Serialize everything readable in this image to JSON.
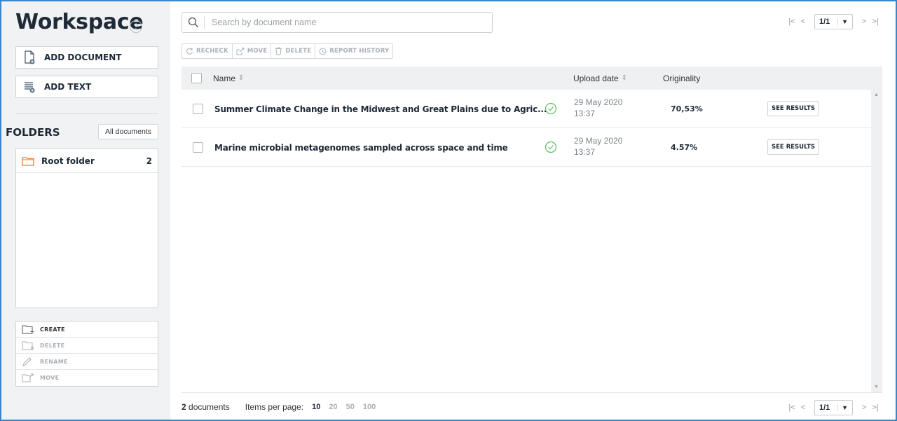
{
  "sidebar": {
    "title": "Workspace",
    "help_icon": "?",
    "add_document_label": "ADD DOCUMENT",
    "add_text_label": "ADD TEXT",
    "folders_title": "FOLDERS",
    "all_documents_label": "All documents",
    "folders": [
      {
        "name": "Root folder",
        "count": "2"
      }
    ],
    "folder_actions": [
      {
        "label": "CREATE",
        "icon": "folder-plus-icon",
        "enabled": true
      },
      {
        "label": "DELETE",
        "icon": "folder-delete-icon",
        "enabled": false
      },
      {
        "label": "RENAME",
        "icon": "pencil-icon",
        "enabled": false
      },
      {
        "label": "MOVE",
        "icon": "folder-move-icon",
        "enabled": false
      }
    ]
  },
  "search": {
    "placeholder": "Search by document name",
    "value": ""
  },
  "toolbar": {
    "recheck": "RECHECK",
    "move": "MOVE",
    "delete": "DELETE",
    "report_history": "REPORT HISTORY"
  },
  "pager": {
    "first": "|<",
    "prev": "<",
    "page": "1/1",
    "next": ">",
    "last": ">|"
  },
  "table": {
    "columns": {
      "name": "Name",
      "upload_date": "Upload date",
      "originality": "Originality"
    },
    "rows": [
      {
        "name": "Summer Climate Change in the Midwest and Great Plains due to Agric...",
        "status": "checked",
        "date": "29 May 2020",
        "time": "13:37",
        "originality": "70,53%",
        "action": "SEE RESULTS"
      },
      {
        "name": "Marine microbial metagenomes sampled across space and time",
        "status": "checked",
        "date": "29 May 2020",
        "time": "13:37",
        "originality": "4.57%",
        "action": "SEE RESULTS"
      }
    ]
  },
  "footer": {
    "count": "2",
    "count_suffix": "documents",
    "items_per_page_label": "Items per page:",
    "per_page_options": [
      "10",
      "20",
      "50",
      "100"
    ],
    "per_page_selected": "10"
  },
  "colors": {
    "frame": "#3a86c8",
    "folder_icon": "#f07a32",
    "status_green": "#5cbf5c"
  }
}
